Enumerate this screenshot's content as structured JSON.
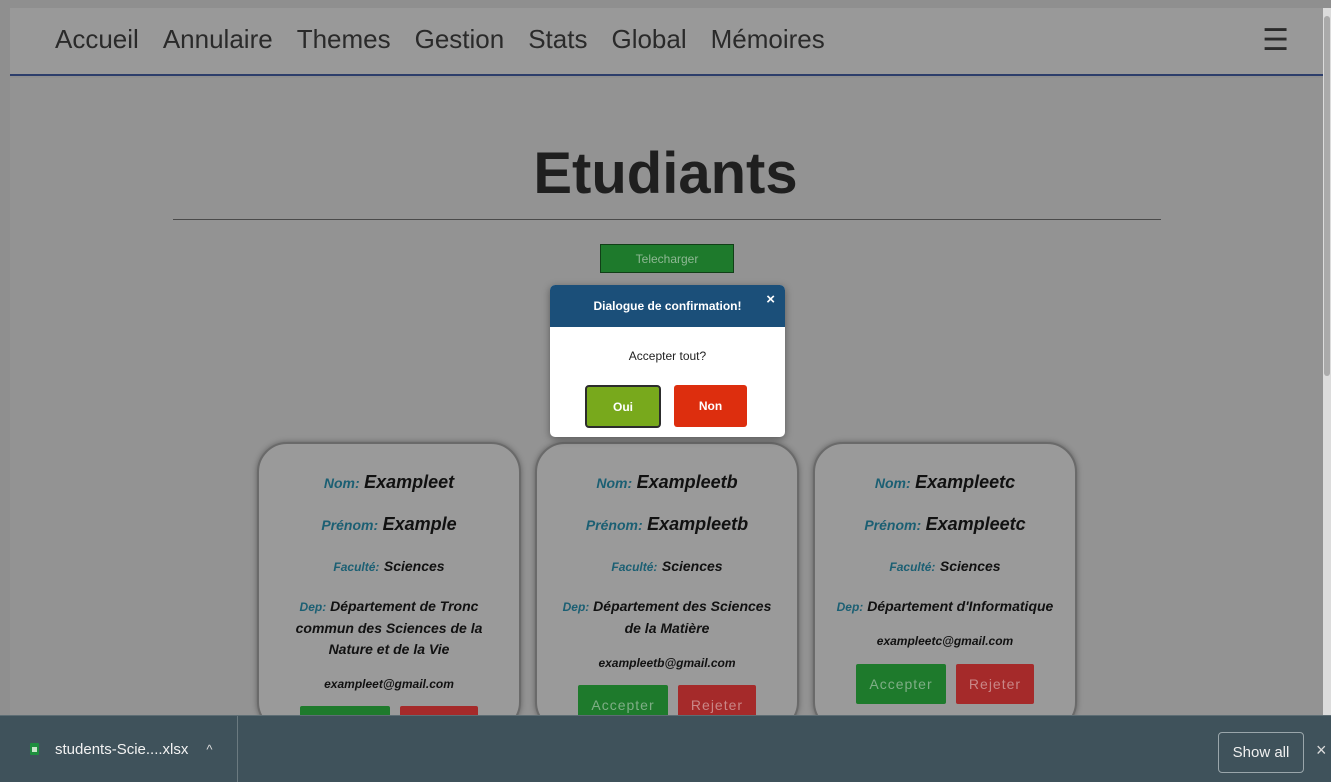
{
  "nav": {
    "links": [
      "Accueil",
      "Annulaire",
      "Themes",
      "Gestion",
      "Stats",
      "Global",
      "Mémoires"
    ],
    "menu_icon": "☰"
  },
  "page": {
    "title": "Etudiants",
    "download_label": "Telecharger"
  },
  "labels": {
    "nom": "Nom:",
    "prenom": "Prénom:",
    "faculte": "Faculté:",
    "dep": "Dep:",
    "accept": "Accepter",
    "reject": "Rejeter"
  },
  "students": [
    {
      "nom": "Exampleet",
      "prenom": "Example",
      "faculte": "Sciences",
      "dep": "Département de Tronc commun des Sciences de la Nature et de la Vie",
      "email": "exampleet@gmail.com"
    },
    {
      "nom": "Exampleetb",
      "prenom": "Exampleetb",
      "faculte": "Sciences",
      "dep": "Département des Sciences de la Matière",
      "email": "exampleetb@gmail.com"
    },
    {
      "nom": "Exampleetc",
      "prenom": "Exampleetc",
      "faculte": "Sciences",
      "dep": "Département d'Informatique",
      "email": "exampleetc@gmail.com"
    }
  ],
  "dialog": {
    "title": "Dialogue de confirmation!",
    "close": "×",
    "message": "Accepter tout?",
    "yes": "Oui",
    "no": "Non"
  },
  "download_bar": {
    "file_name": "students-Scie....xlsx",
    "chevron": "^",
    "show_all": "Show all",
    "close": "×"
  },
  "colors": {
    "accent_green": "#1e7a2c",
    "reject_red": "#a52a2a",
    "dialog_header": "#1b4f79",
    "yes_green": "#78a91c",
    "no_red": "#dd2e0e"
  }
}
